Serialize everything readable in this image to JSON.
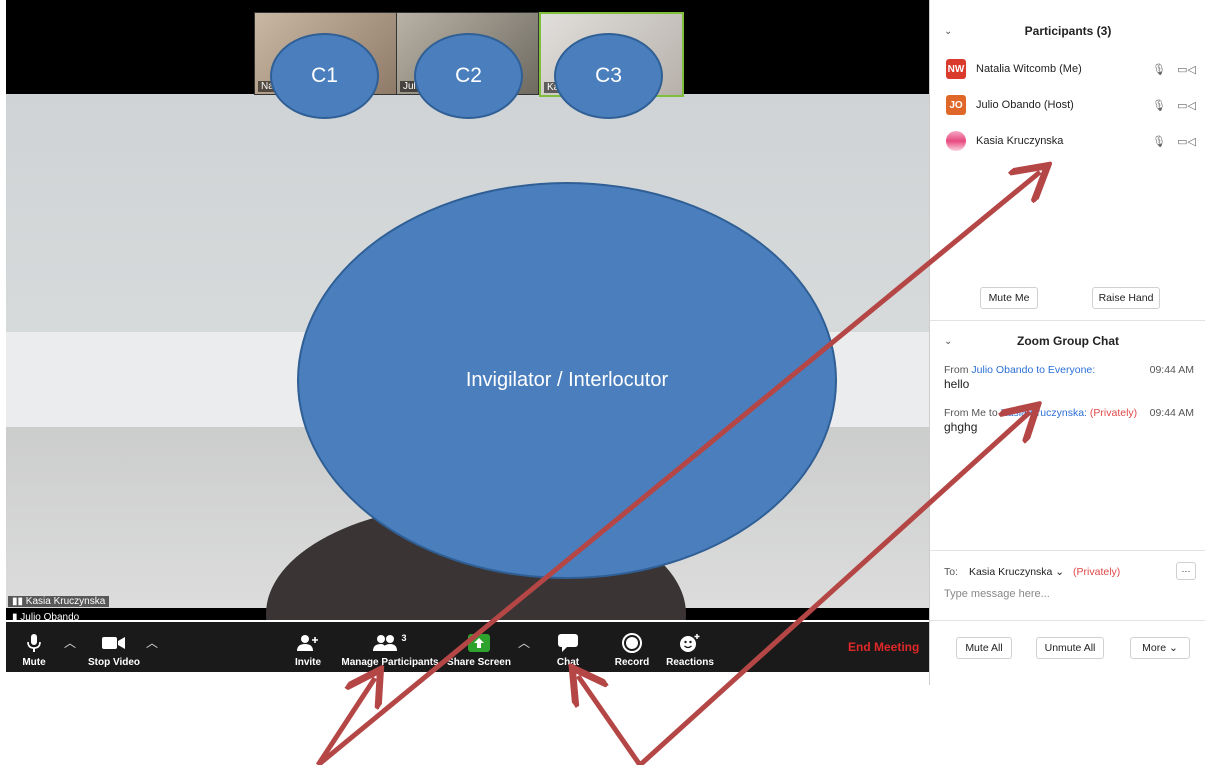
{
  "thumbnails": [
    {
      "name": "Na",
      "annotation": "C1"
    },
    {
      "name": "Julio",
      "annotation": "C2"
    },
    {
      "name": "Ka",
      "annotation": "C3"
    }
  ],
  "main_annotation": "Invigilator / Interlocutor",
  "active_speaker": "Kasia Kruczynska",
  "secondary_speaker": "Julio Obando",
  "toolbar": {
    "mute": "Mute",
    "stop_video": "Stop Video",
    "invite": "Invite",
    "manage_participants": "Manage Participants",
    "participant_count": "3",
    "share_screen": "Share Screen",
    "chat": "Chat",
    "record": "Record",
    "reactions": "Reactions",
    "end_meeting": "End Meeting"
  },
  "participants_panel": {
    "title": "Participants (3)",
    "participants": [
      {
        "initials": "NW",
        "name": "Natalia Witcomb (Me)",
        "color": "#d93a2b"
      },
      {
        "initials": "JO",
        "name": "Julio Obando (Host)",
        "color": "#e0672a"
      },
      {
        "initials": "",
        "name": "Kasia Kruczynska",
        "color": "#f06b9a"
      }
    ],
    "mute_me": "Mute Me",
    "raise_hand": "Raise Hand"
  },
  "chat_panel": {
    "title": "Zoom Group Chat",
    "messages": [
      {
        "from": "From",
        "sender": "Julio Obando",
        "to": "to Everyone:",
        "private": "",
        "time": "09:44 AM",
        "text": "hello"
      },
      {
        "from": "From Me to",
        "sender": "Kasia Kruczynska:",
        "to": "",
        "private": "(Privately)",
        "time": "09:44 AM",
        "text": "ghghg"
      }
    ],
    "to_label": "To:",
    "recipient": "Kasia Kruczynska",
    "privately": "(Privately)",
    "more_dots": "···",
    "placeholder": "Type message here..."
  },
  "bottom_buttons": {
    "mute_all": "Mute All",
    "unmute_all": "Unmute All",
    "more": "More"
  },
  "colors": {
    "annotation_fill": "#4a7ebd",
    "arrow": "#b54646",
    "end_meeting": "#e02828"
  }
}
